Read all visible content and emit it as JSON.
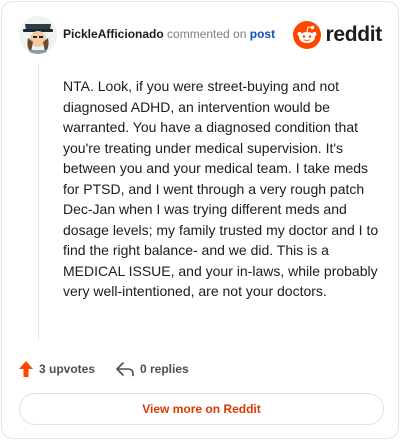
{
  "comment": {
    "author": "PickleAfficionado",
    "action_text": "commented on",
    "post_link": "post",
    "body": "NTA. Look, if you were street-buying and not diagnosed ADHD, an intervention would be warranted. You have a diagnosed condition that you're treating under medical supervision. It's between you and your medical team. I take meds for PTSD, and I went through a very rough patch Dec-Jan when I was trying different meds and dosage levels; my family trusted my doctor and I to find the right balance- and we did. This is a MEDICAL ISSUE, and your in-laws, while probably very well-intentioned, are not your doctors."
  },
  "brand": {
    "wordmark": "reddit",
    "color": "#ff4500"
  },
  "stats": {
    "upvotes": "3 upvotes",
    "replies": "0 replies"
  },
  "footer": {
    "view_more": "View more on Reddit"
  },
  "icons": {
    "avatar": "user-avatar",
    "logo": "reddit-snoo-logo",
    "upvote": "upvote-arrow-icon",
    "reply": "reply-arrow-icon"
  }
}
